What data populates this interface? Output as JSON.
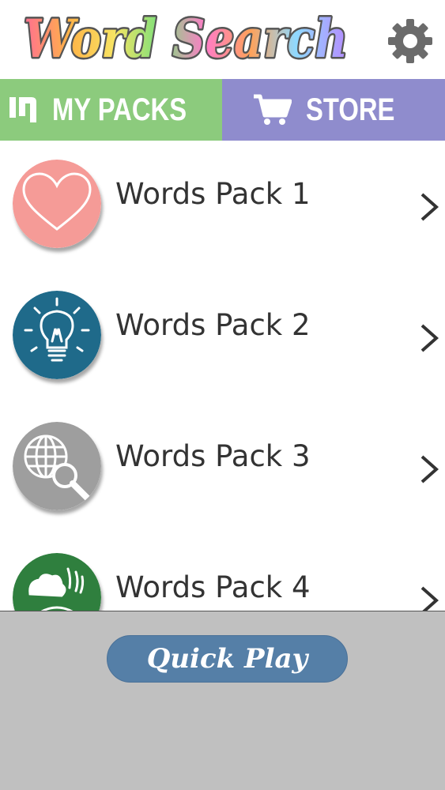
{
  "header": {
    "title": "Word Search",
    "settings_icon": "gear-icon"
  },
  "tabs": [
    {
      "label": "MY PACKS",
      "icon": "packs-icon",
      "color": "#8ccb7d"
    },
    {
      "label": "STORE",
      "icon": "cart-icon",
      "color": "#8f8ccd"
    }
  ],
  "packs": [
    {
      "label": "Words Pack 1",
      "icon": "heart-icon",
      "color": "#f59b97"
    },
    {
      "label": "Words Pack 2",
      "icon": "lightbulb-icon",
      "color": "#1f6a8a"
    },
    {
      "label": "Words Pack 3",
      "icon": "globe-search-icon",
      "color": "#9e9e9e"
    },
    {
      "label": "Words Pack 4",
      "icon": "nature-icon",
      "color": "#2f7f3e"
    }
  ],
  "quick_play": {
    "label": "Quick Play",
    "color": "#557fa7"
  },
  "colors": {
    "bottom_panel": "#c0c0c0",
    "text": "#333333"
  }
}
